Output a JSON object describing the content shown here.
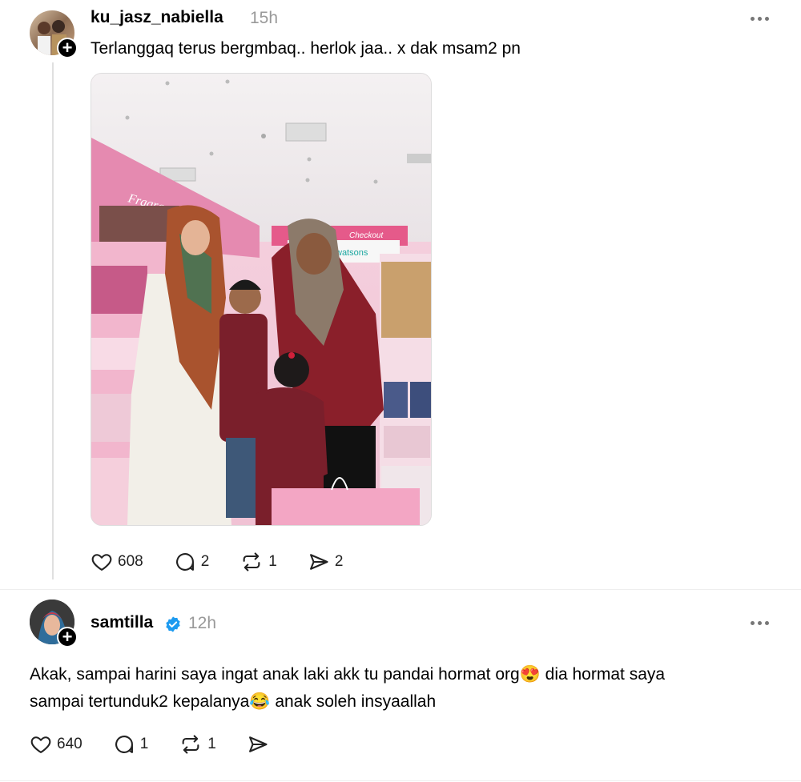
{
  "post": {
    "username": "ku_jasz_nabiella",
    "time": "15h",
    "text": "Terlanggaq terus bergmbaq.. herlok jaa.. x dak msam2 pn",
    "likes": "608",
    "replies": "2",
    "reposts": "1",
    "shares": "2"
  },
  "reply": {
    "username": "samtilla",
    "time": "12h",
    "text_line1": "Akak, sampai harini saya ingat anak laki akk tu pandai hormat org😍 dia hormat saya",
    "text_line2": "sampai tertunduk2 kepalanya😂 anak soleh insyaallah",
    "likes": "640",
    "replies": "1",
    "reposts": "1"
  },
  "photo": {
    "signs": {
      "fragrance": "Fragrance",
      "checkout": "Checkout",
      "watsons": "watsons"
    }
  },
  "colors": {
    "verified": "#1d9bf0",
    "store_pink": "#f3a6c4",
    "maroon": "#8a1f2a"
  }
}
